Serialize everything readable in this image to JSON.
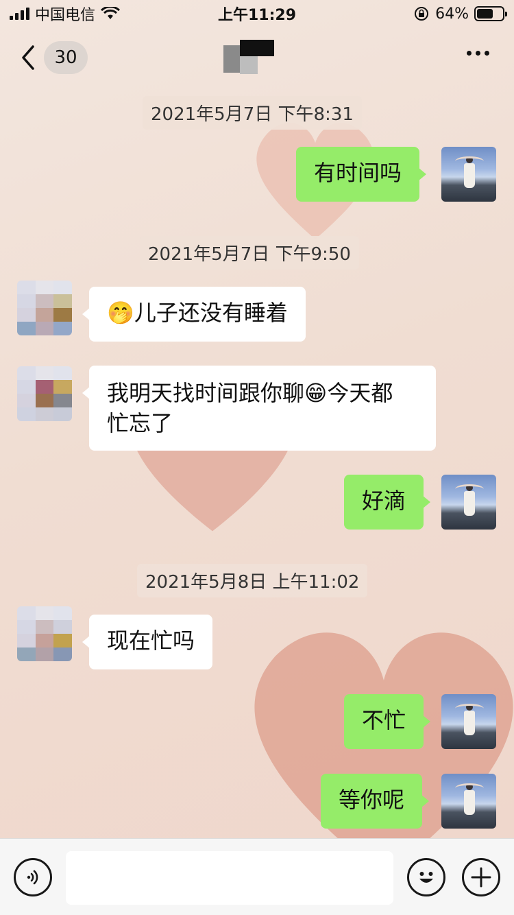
{
  "status_bar": {
    "carrier": "中国电信",
    "time": "上午11:29",
    "battery": "64%",
    "battery_level": 0.64
  },
  "nav": {
    "unread_count": "30"
  },
  "chat": {
    "timestamps": [
      "2021年5月7日 下午8:31",
      "2021年5月7日 下午9:50",
      "2021年5月8日 上午11:02"
    ],
    "messages": [
      {
        "side": "right",
        "text": "有时间吗"
      },
      {
        "side": "left",
        "emoji": "🤭",
        "text": "儿子还没有睡着"
      },
      {
        "side": "left",
        "text_a": "我明天找时间跟你聊",
        "emoji": "😁",
        "text_b": "今天都",
        "text_c": "忙忘了"
      },
      {
        "side": "right",
        "text": "好滴"
      },
      {
        "side": "left",
        "text": "现在忙吗"
      },
      {
        "side": "right",
        "text": "不忙"
      },
      {
        "side": "right",
        "text": "等你呢"
      }
    ]
  },
  "colors": {
    "bubble_right": "#95ec69",
    "bubble_left": "#ffffff",
    "wallpaper": "#f0ddd2"
  },
  "icons": {
    "back": "chevron-left-icon",
    "more": "ellipsis-icon",
    "voice": "voice-icon",
    "emoji": "smiley-icon",
    "plus": "plus-icon"
  }
}
